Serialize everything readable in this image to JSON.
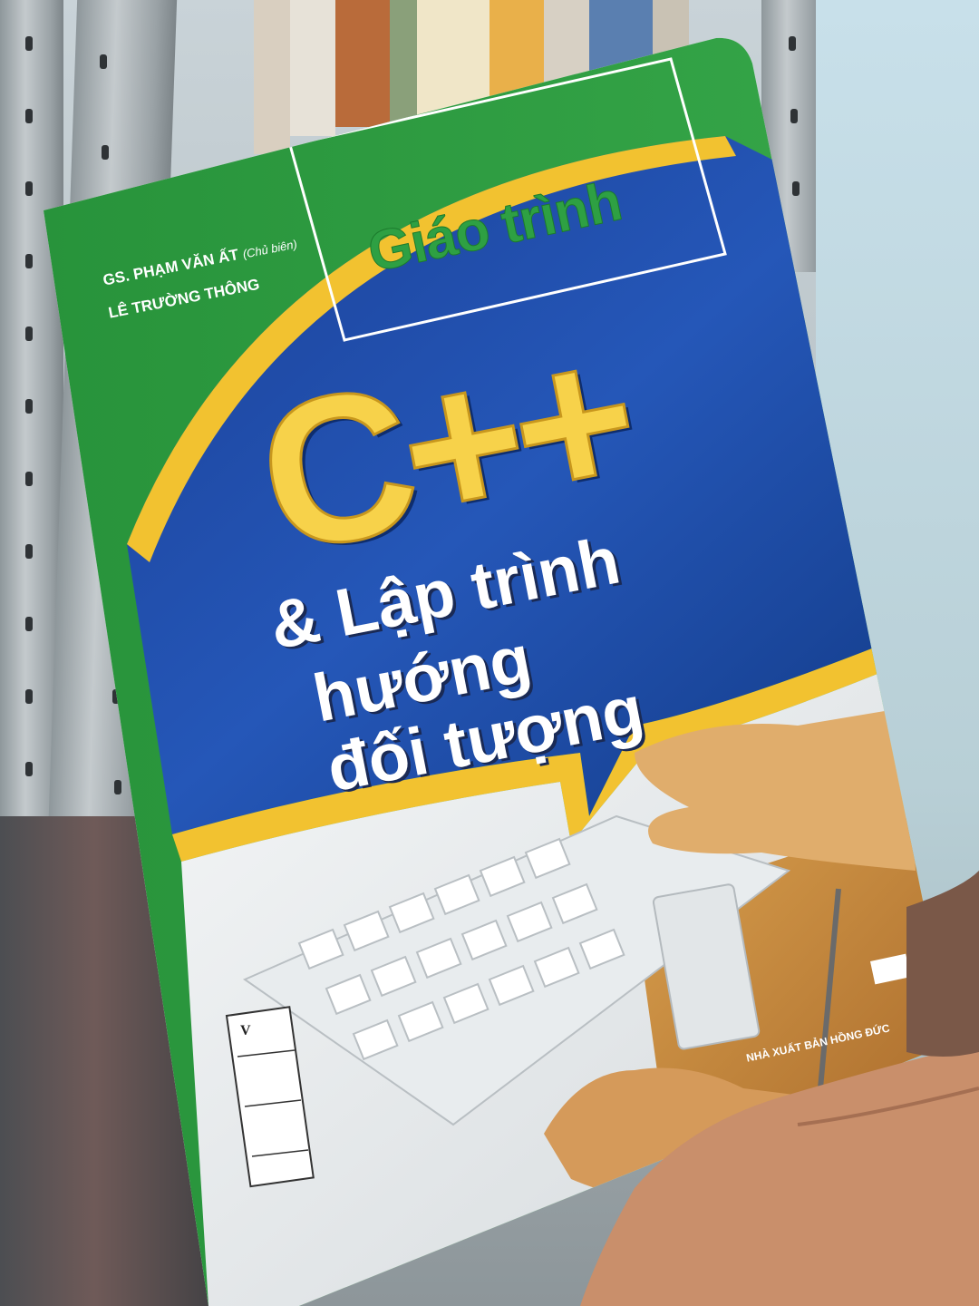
{
  "book": {
    "series_title": "Giáo trình",
    "authors": {
      "line1": "GS. PHẠM VĂN ẤT",
      "line1_role": "(Chủ biên)",
      "line2": "LÊ TRƯỜNG THÔNG"
    },
    "title_main": "C++",
    "title_sub_lines": [
      "& Lập trình",
      "hướng",
      "đối tượng"
    ],
    "publisher": "NHÀ XUẤT BẢN HỒNG ĐỨC",
    "library_sticker_letter": "V"
  },
  "colors": {
    "cover_green": "#2ea043",
    "cover_blue": "#1f4aa8",
    "accent_yellow": "#f2c230",
    "title_yellow": "#f7d24a",
    "white": "#ffffff",
    "wood": "#c98a3a"
  }
}
